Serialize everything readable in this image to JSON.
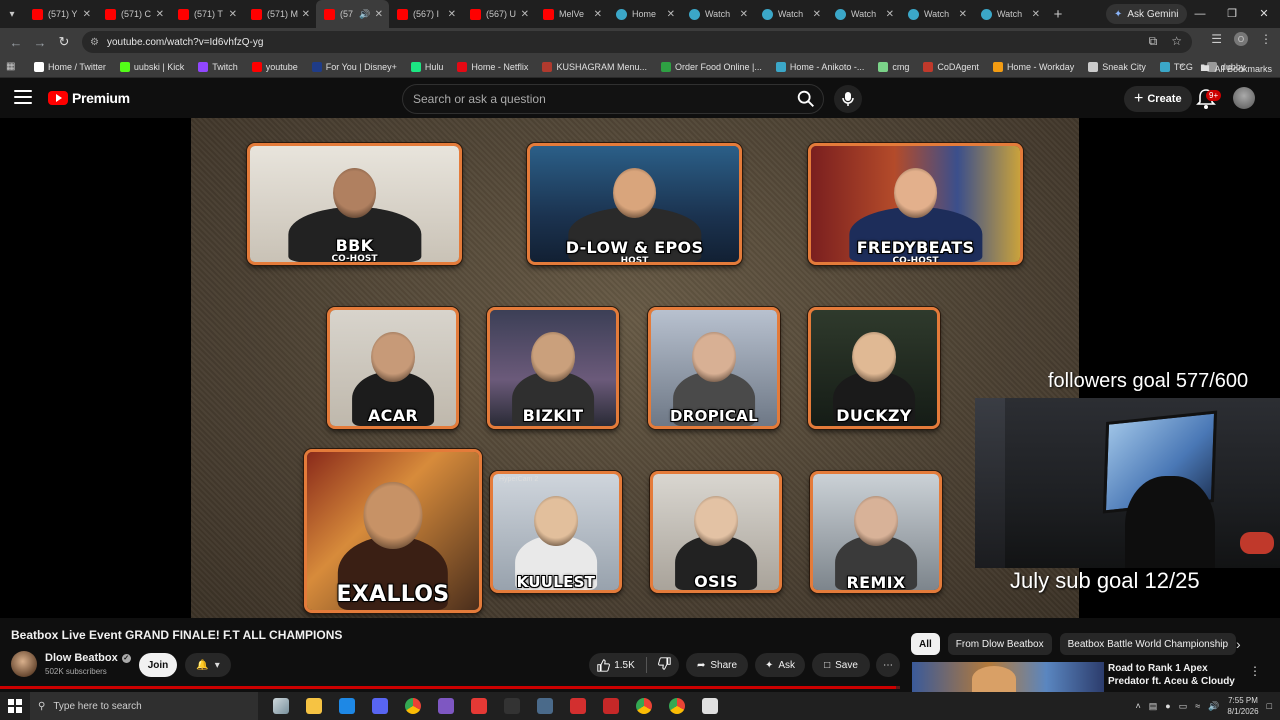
{
  "browser": {
    "tabs": [
      {
        "title": "(571) Y",
        "favicon": "youtube-icon",
        "color": "#ff0000"
      },
      {
        "title": "(571) C",
        "favicon": "youtube-icon",
        "color": "#ff0000"
      },
      {
        "title": "(571) T",
        "favicon": "youtube-icon",
        "color": "#ff0000"
      },
      {
        "title": "(571) M",
        "favicon": "youtube-icon",
        "color": "#ff0000"
      },
      {
        "title": "(57",
        "favicon": "youtube-icon",
        "color": "#ff0000",
        "active": true
      },
      {
        "title": "(567) I",
        "favicon": "youtube-icon",
        "color": "#ff0000"
      },
      {
        "title": "(567) U",
        "favicon": "youtube-icon",
        "color": "#ff0000"
      },
      {
        "title": "MelVe",
        "favicon": "youtube-icon",
        "color": "#ff0000"
      },
      {
        "title": "Home",
        "favicon": "globe-icon",
        "color": "#3ba7c8"
      },
      {
        "title": "Watch",
        "favicon": "globe-icon",
        "color": "#3ba7c8"
      },
      {
        "title": "Watch",
        "favicon": "globe-icon",
        "color": "#3ba7c8"
      },
      {
        "title": "Watch",
        "favicon": "globe-icon",
        "color": "#3ba7c8"
      },
      {
        "title": "Watch",
        "favicon": "globe-icon",
        "color": "#3ba7c8"
      },
      {
        "title": "Watch",
        "favicon": "globe-icon",
        "color": "#3ba7c8"
      }
    ],
    "ask_gemini": "Ask Gemini",
    "url": "youtube.com/watch?v=Id6vhfzQ-yg",
    "profile_initial": "O",
    "bookmarks": [
      {
        "label": "Home / Twitter",
        "color": "#ffffff"
      },
      {
        "label": "uubski | Kick",
        "color": "#53fc18"
      },
      {
        "label": "Twitch",
        "color": "#9146ff"
      },
      {
        "label": "youtube",
        "color": "#ff0000"
      },
      {
        "label": "For You | Disney+",
        "color": "#1f3c88"
      },
      {
        "label": "Hulu",
        "color": "#1ce783"
      },
      {
        "label": "Home - Netflix",
        "color": "#e50914"
      },
      {
        "label": "KUSHAGRAM Menu...",
        "color": "#b03a2e"
      },
      {
        "label": "Order Food Online |...",
        "color": "#2ea043"
      },
      {
        "label": "Home - Anikoto -...",
        "color": "#3ba7c8"
      },
      {
        "label": "cmg",
        "color": "#7bd389"
      },
      {
        "label": "CoDAgent",
        "color": "#c0392b"
      },
      {
        "label": "Home - Workday",
        "color": "#f39c12"
      },
      {
        "label": "Sneak City",
        "color": "#cccccc"
      },
      {
        "label": "TCG",
        "color": "#3ba7c8"
      },
      {
        "label": "dubby",
        "color": "#999999"
      }
    ],
    "all_bookmarks": "All Bookmarks"
  },
  "youtube": {
    "logo_text": "Premium",
    "search_placeholder": "Search or ask a question",
    "create_label": "Create",
    "notif_badge": "9+"
  },
  "video": {
    "title": "Beatbox Live Event GRAND FINALE! F.T ALL CHAMPIONS",
    "progress_fraction": 0.995,
    "participants": [
      {
        "name": "BBK",
        "role": "CO-HOST"
      },
      {
        "name": "D-LOW & EPOS",
        "role": "HOST"
      },
      {
        "name": "FREDYBEATS",
        "role": "CO-HOST"
      },
      {
        "name": "ACAR"
      },
      {
        "name": "BIZKIT"
      },
      {
        "name": "DROPICAL"
      },
      {
        "name": "DUCKZY"
      },
      {
        "name": "EXALLOS"
      },
      {
        "name": "KUULEST",
        "tag": "HyperCam 2"
      },
      {
        "name": "OSIS"
      },
      {
        "name": "REMIX"
      }
    ],
    "followers_goal": "followers goal 577/600",
    "sub_goal": "July sub goal 12/25"
  },
  "channel": {
    "name": "Dlow Beatbox",
    "subscribers": "502K subscribers",
    "join_label": "Join"
  },
  "actions": {
    "likes": "1.5K",
    "share": "Share",
    "ask": "Ask",
    "save": "Save"
  },
  "sidebar": {
    "chips": [
      "All",
      "From Dlow Beatbox",
      "Beatbox Battle World Championship"
    ],
    "recommendation": {
      "title": "Road to Rank 1 Apex Predator ft. Aceu & Cloudy"
    }
  },
  "taskbar": {
    "search_placeholder": "Type here to search",
    "time": "7:55 PM",
    "date": "8/1/2026"
  }
}
